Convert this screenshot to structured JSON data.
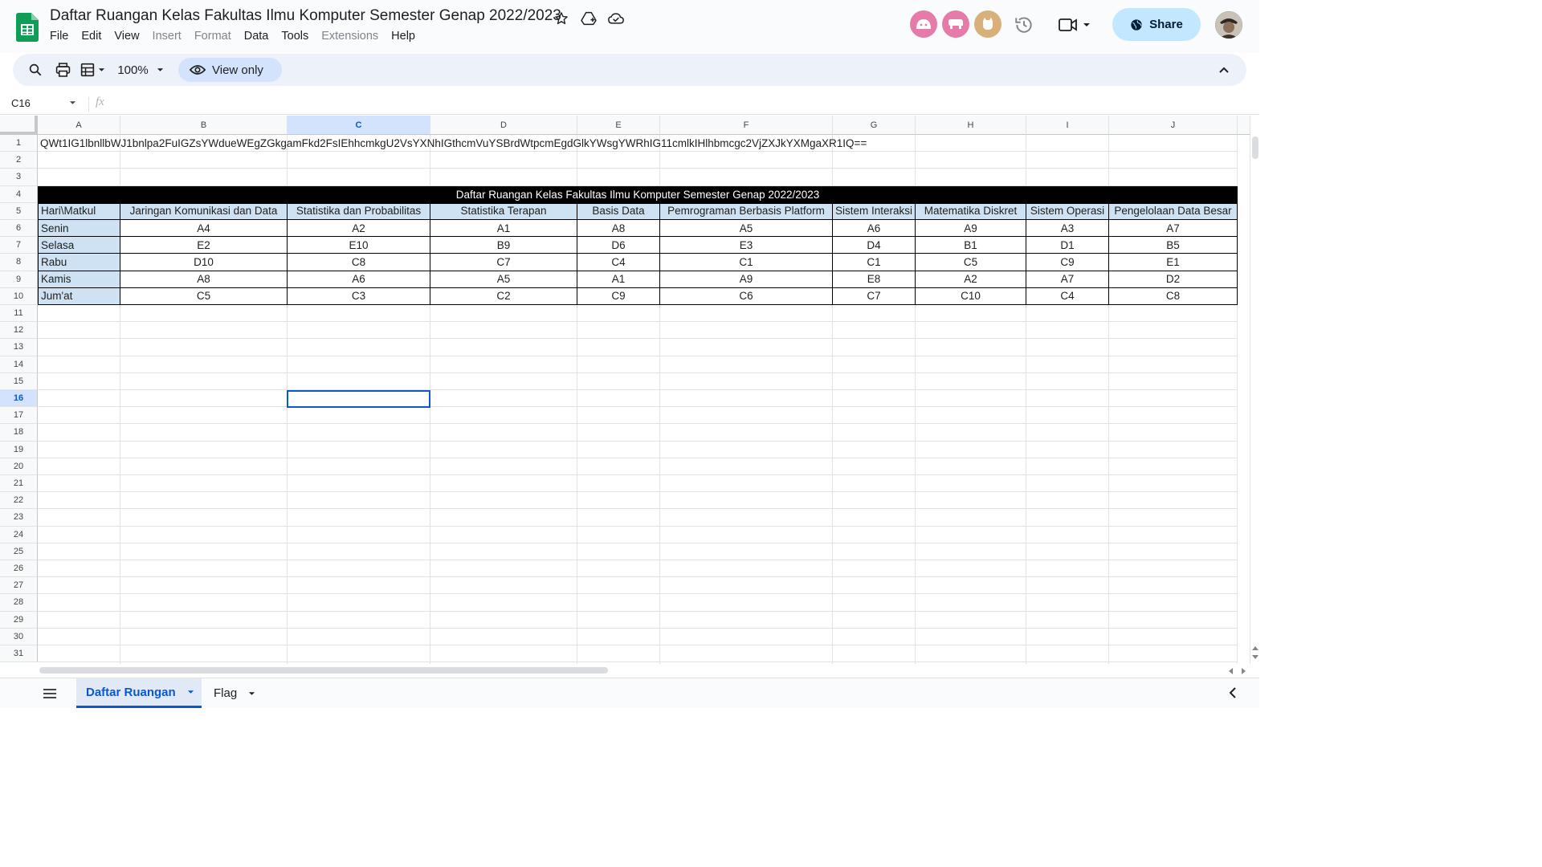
{
  "document": {
    "title": "Daftar Ruangan Kelas Fakultas Ilmu Komputer Semester Genap 2022/2023"
  },
  "menu": [
    "File",
    "Edit",
    "View",
    "Insert",
    "Format",
    "Data",
    "Tools",
    "Extensions",
    "Help"
  ],
  "menu_disabled": [
    "Insert",
    "Format",
    "Extensions"
  ],
  "header": {
    "share_label": "Share",
    "avatar_colors": [
      "#e57ba8",
      "#e57ba8",
      "#d9b07a"
    ]
  },
  "toolbar": {
    "zoom": "100%",
    "view_only_label": "View only"
  },
  "formula_bar": {
    "name_box": "C16",
    "fx_label": "fx"
  },
  "grid": {
    "columns": [
      "A",
      "B",
      "C",
      "D",
      "E",
      "F",
      "G",
      "H",
      "I",
      "J"
    ],
    "selected_column": "C",
    "selected_row": 16,
    "row_count": 31,
    "row1_text": "QWt1IG1lbnllbWJ1bnlpa2FuIGZsYWdueWEgZGkgamFkd2FsIEhhcmkgU2VsYXNhIGthcmVuYSBrdWtpcmEgdGlkYWsgYWRhIG11cmlkIHlhbmcgc2VjZXJkYXMgaXR1IQ==",
    "table_title": "Daftar Ruangan Kelas Fakultas Ilmu Komputer Semester Genap 2022/2023",
    "table_headers": [
      "Hari\\Matkul",
      "Jaringan Komunikasi dan Data",
      "Statistika dan Probabilitas",
      "Statistika Terapan",
      "Basis Data",
      "Pemrograman Berbasis Platform",
      "Sistem Interaksi",
      "Matematika Diskret",
      "Sistem Operasi",
      "Pengelolaan Data Besar"
    ],
    "table_rows": [
      [
        "Senin",
        "A4",
        "A2",
        "A1",
        "A8",
        "A5",
        "A6",
        "A9",
        "A3",
        "A7"
      ],
      [
        "Selasa",
        "E2",
        "E10",
        "B9",
        "D6",
        "E3",
        "D4",
        "B1",
        "D1",
        "B5"
      ],
      [
        "Rabu",
        "D10",
        "C8",
        "C7",
        "C4",
        "C1",
        "C1",
        "C5",
        "C9",
        "E1"
      ],
      [
        "Kamis",
        "A8",
        "A6",
        "A5",
        "A1",
        "A9",
        "E8",
        "A2",
        "A7",
        "D2"
      ],
      [
        "Jum'at",
        "C5",
        "C3",
        "C2",
        "C9",
        "C6",
        "C7",
        "C10",
        "C4",
        "C8"
      ]
    ],
    "header_fill": "#cfe2f3"
  },
  "sheets": {
    "tabs": [
      "Daftar Ruangan",
      "Flag"
    ],
    "active": "Daftar Ruangan"
  },
  "colors": {
    "accent": "#0b57d0",
    "share_bg": "#c2e7ff",
    "sheets_green": "#0f9d58"
  }
}
